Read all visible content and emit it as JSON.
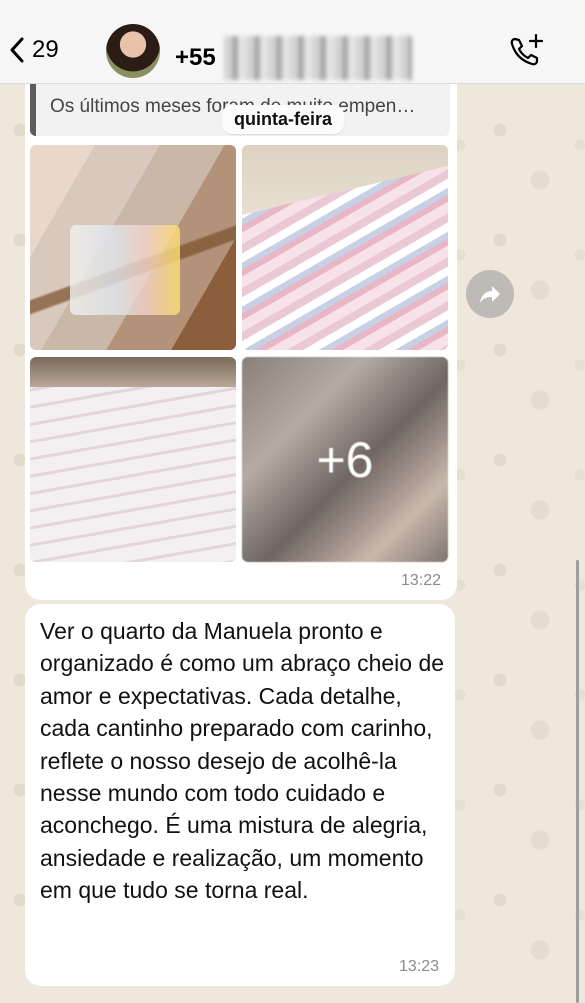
{
  "header": {
    "back_count": "29",
    "contact_prefix": "+55",
    "add_call_icon": "phone-plus-icon"
  },
  "chat": {
    "date_divider": "quinta-feira",
    "message1": {
      "quoted_text": "Os últimos meses foram de muito empen…",
      "extra_photos": "+6",
      "time": "13:22"
    },
    "message2": {
      "text": "Ver o quarto da Manuela pronto e organizado é como um abraço cheio de amor e expectativas. Cada detalhe, cada cantinho preparado com carinho, reflete o nosso desejo de acolhê-la nesse mundo com todo cuidado e aconchego. É uma mistura de alegria, ansiedade e realização, um momento em que tudo se torna real.",
      "time": "13:23"
    }
  }
}
